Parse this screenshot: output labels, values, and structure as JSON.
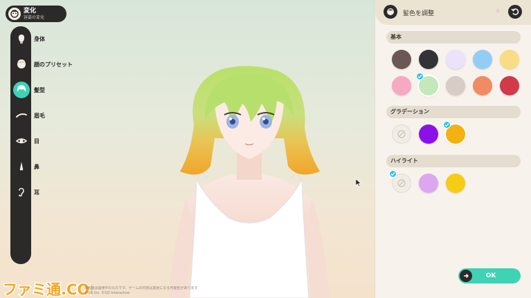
{
  "header": {
    "title": "変化",
    "subtitle": "容姿の変化",
    "icon": "character-face-icon"
  },
  "menu": {
    "items": [
      {
        "label": "身体",
        "icon": "head-icon",
        "active": false
      },
      {
        "label": "顔のプリセット",
        "icon": "face-preset-icon",
        "active": false
      },
      {
        "label": "髪型",
        "icon": "hairstyle-icon",
        "active": true
      },
      {
        "label": "眉毛",
        "icon": "eyebrow-icon",
        "active": false
      },
      {
        "label": "目",
        "icon": "eye-icon",
        "active": false
      },
      {
        "label": "鼻",
        "icon": "nose-icon",
        "active": false
      },
      {
        "label": "耳",
        "icon": "ear-icon",
        "active": false
      }
    ]
  },
  "panel": {
    "title": "髪色を調整",
    "sections": {
      "basic": {
        "label": "基本",
        "colors": [
          "#6b5854",
          "#333236",
          "#ece2fb",
          "#93cdf6",
          "#f8dd85",
          "#f5a9c2",
          "#c3e8b9",
          "#d8ccc6",
          "#f28a63",
          "#d13a48"
        ],
        "selected_index": 6
      },
      "gradation": {
        "label": "グラデーション",
        "colors": [
          "none",
          "#8a12e8",
          "#f3b212"
        ],
        "selected_index": 2
      },
      "highlight": {
        "label": "ハイライト",
        "colors": [
          "none",
          "#dca6f0",
          "#f6cc14"
        ],
        "selected_index": 0
      }
    },
    "ok_label": "OK"
  },
  "watermark": {
    "logo_text": "ファミ通.COM",
    "fineprint_line1": "※画面は開発中のものです。ゲームの内容は変更になる可能性があります",
    "fineprint_line2": "©XD Inc. ©XD Interactive"
  },
  "colors": {
    "accent": "#3fd2b5",
    "dark": "#2b2a28",
    "check": "#2ec4e8"
  }
}
